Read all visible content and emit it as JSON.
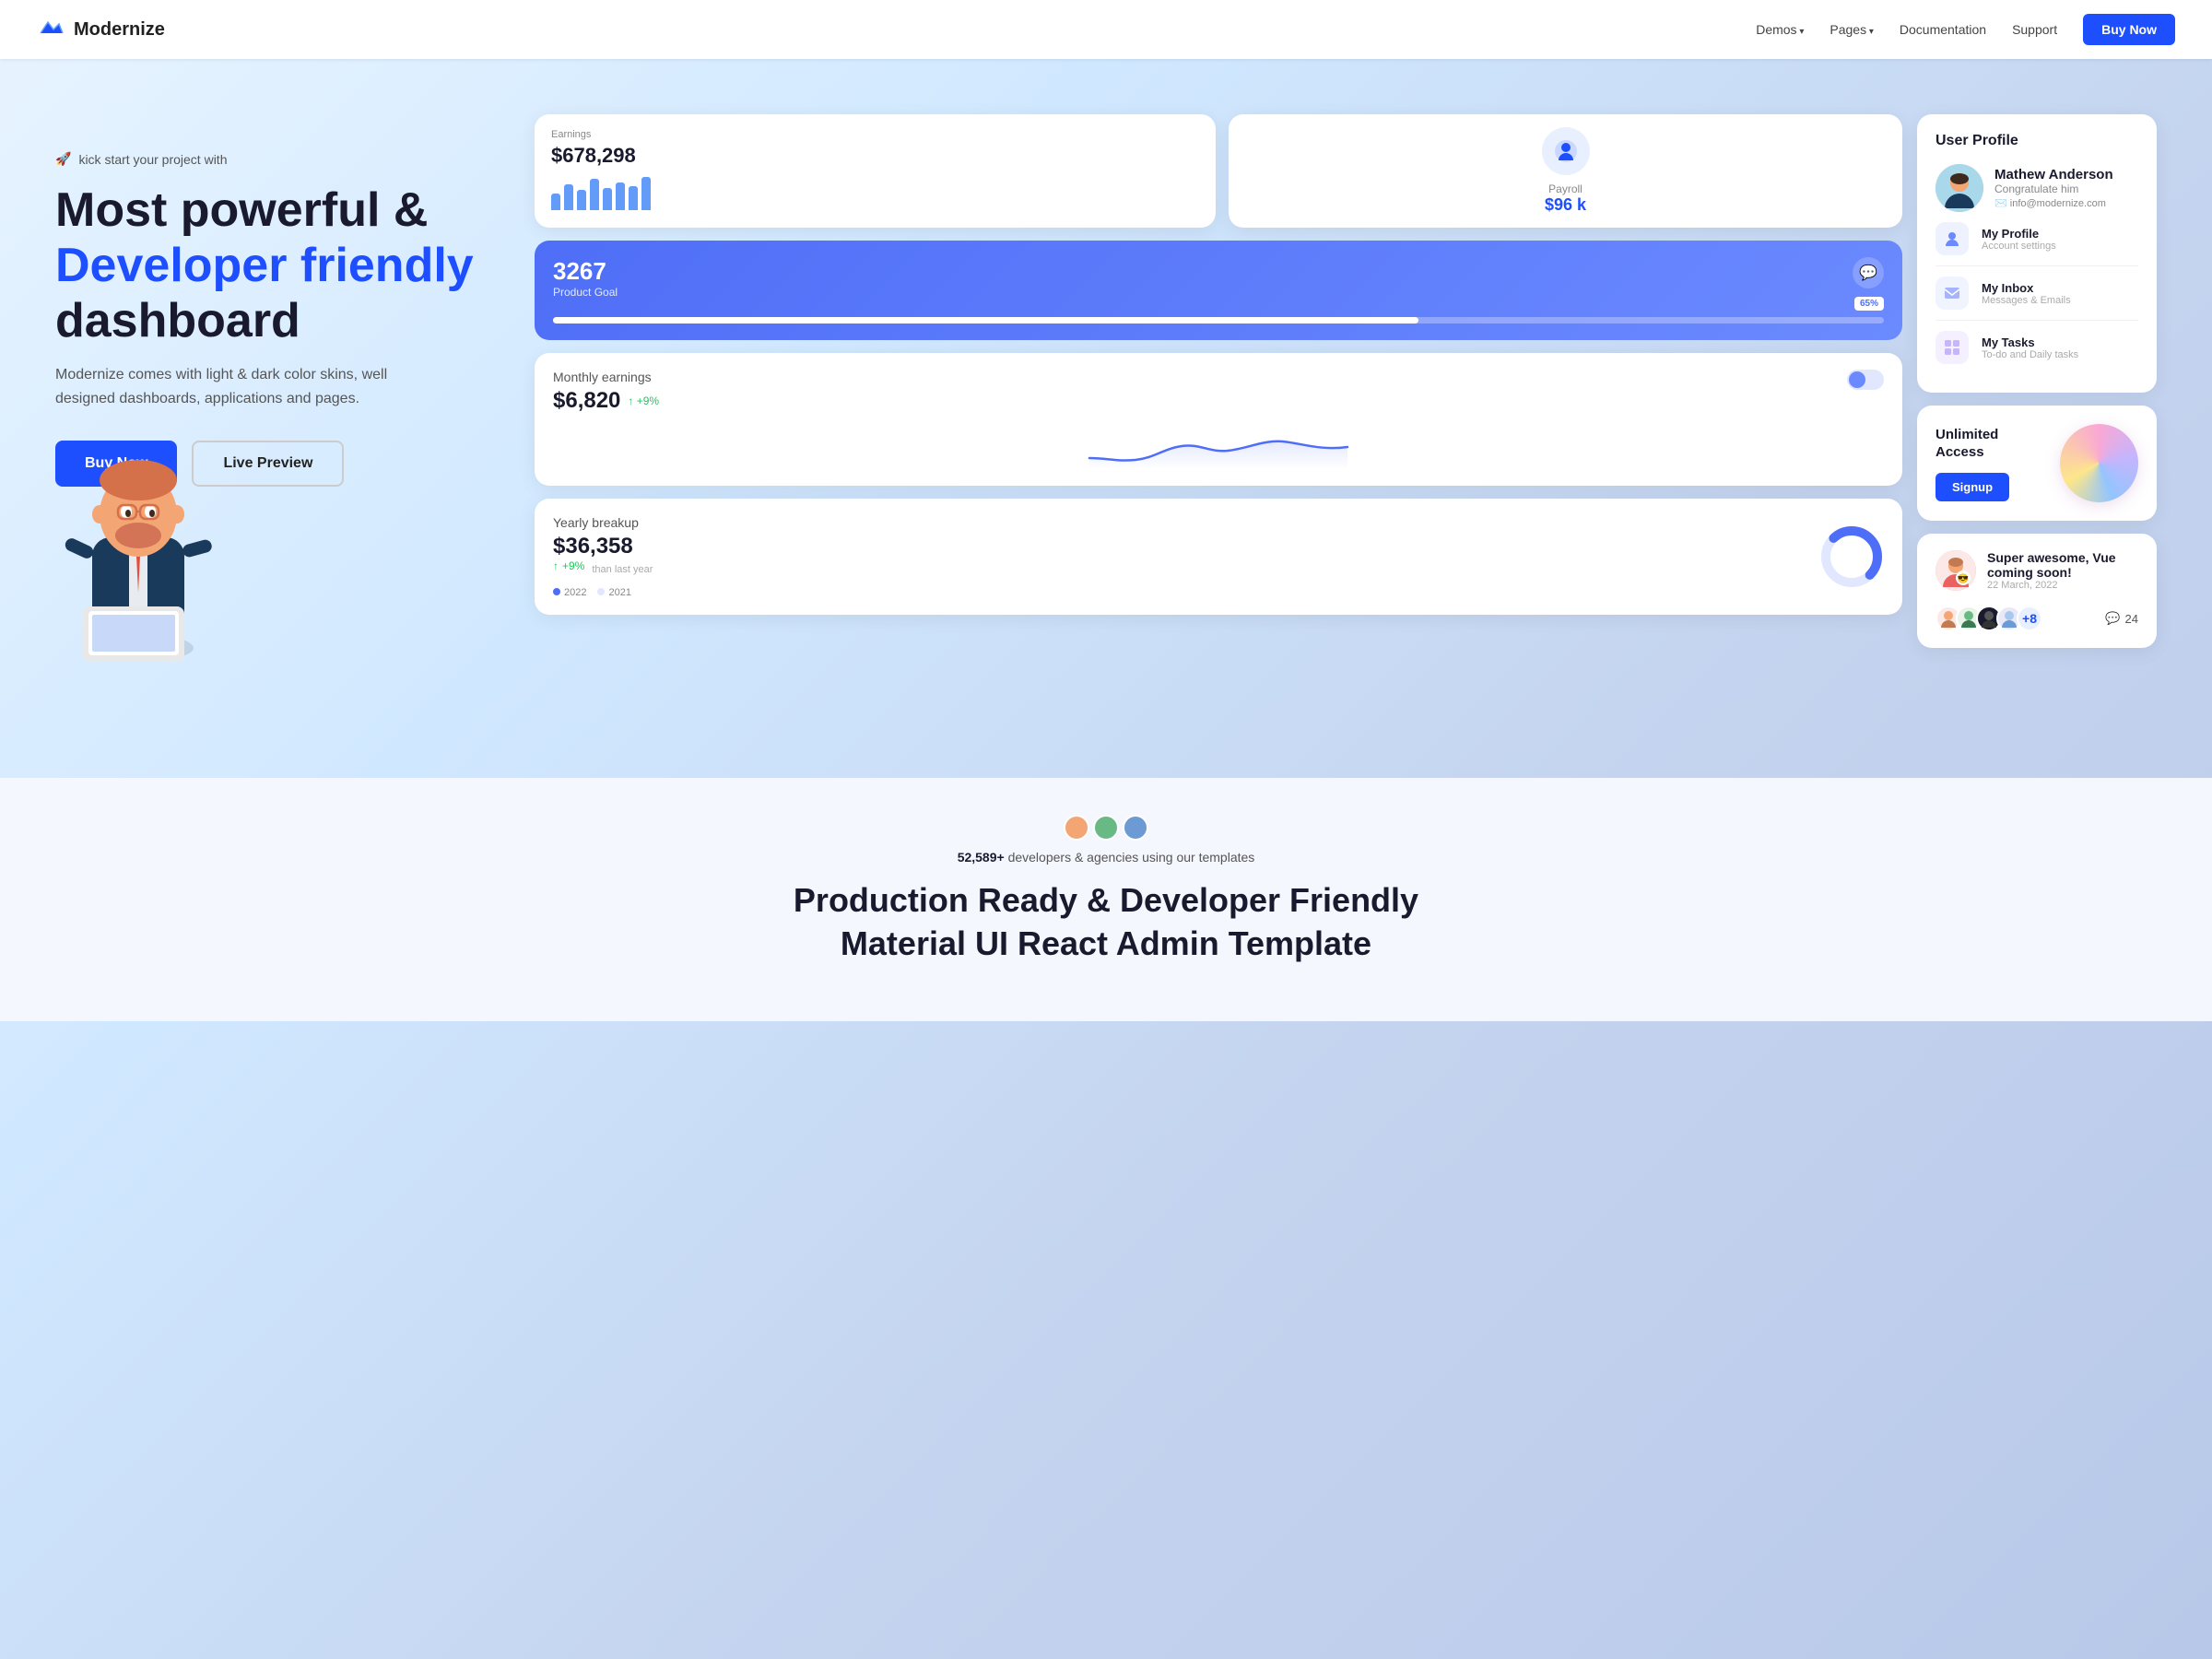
{
  "nav": {
    "logo_text": "Modernize",
    "demos_label": "Demos",
    "pages_label": "Pages",
    "docs_label": "Documentation",
    "support_label": "Support",
    "buynow_label": "Buy Now"
  },
  "hero": {
    "kicker": "kick start your project with",
    "title_line1": "Most powerful &",
    "title_line2": "Developer friendly",
    "title_line3": "dashboard",
    "description": "Modernize comes with light & dark color skins, well designed dashboards, applications and pages.",
    "btn_buy": "Buy Now",
    "btn_preview": "Live Preview"
  },
  "earnings_card": {
    "label": "Earnings",
    "value": "$678,298"
  },
  "payroll_card": {
    "label": "Payroll",
    "value": "$96 k"
  },
  "goal_card": {
    "number": "3267",
    "label": "Product Goal",
    "pct": "65%"
  },
  "monthly_card": {
    "title": "Monthly earnings",
    "amount": "$6,820",
    "trend": "+9%"
  },
  "yearly_card": {
    "title": "Yearly breakup",
    "amount": "$36,358",
    "trend": "+9%",
    "subtext": "than last year",
    "year1": "2022",
    "year2": "2021"
  },
  "profile_panel": {
    "title": "User Profile",
    "user_name": "Mathew Anderson",
    "user_congrats": "Congratulate him",
    "user_email": "info@modernize.com",
    "menu_items": [
      {
        "title": "My Profile",
        "sub": "Account settings",
        "icon": "👤",
        "bg": "#eef2ff"
      },
      {
        "title": "My Inbox",
        "sub": "Messages & Emails",
        "icon": "🗂️",
        "bg": "#f0f4ff"
      },
      {
        "title": "My Tasks",
        "sub": "To-do and Daily tasks",
        "icon": "📋",
        "bg": "#f5f0ff"
      }
    ]
  },
  "unlimited_card": {
    "title": "Unlimited\nAccess",
    "btn_label": "Signup"
  },
  "notif_card": {
    "title": "Super awesome, Vue coming soon!",
    "date": "22 March, 2022",
    "comment_count": "24",
    "extra_avatars": "+8"
  },
  "bottom_section": {
    "stat_count": "52,589+",
    "stat_text": "developers & agencies using our templates",
    "title_line1": "Production Ready & Developer Friendly",
    "title_line2": "Material UI React Admin Template"
  }
}
